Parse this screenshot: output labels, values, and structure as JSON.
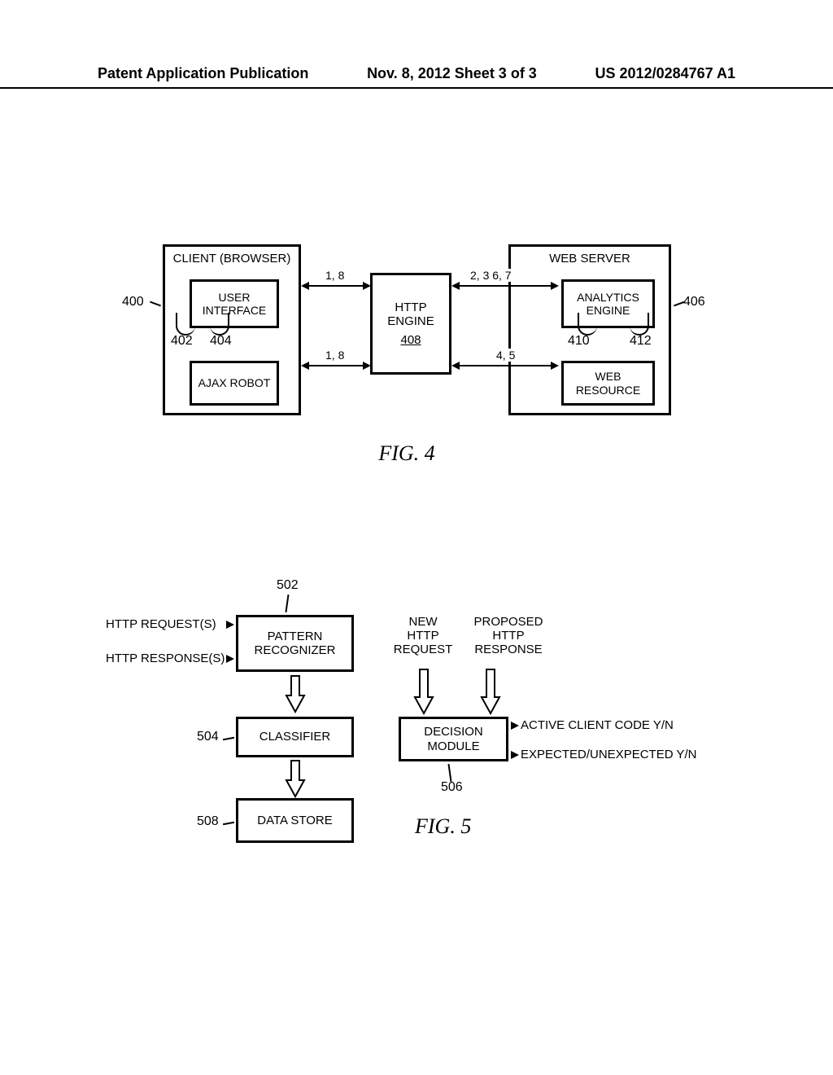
{
  "header": {
    "left": "Patent Application Publication",
    "center": "Nov. 8, 2012  Sheet 3 of 3",
    "right": "US 2012/0284767 A1"
  },
  "fig4": {
    "client_title": "CLIENT (BROWSER)",
    "user_interface": "USER INTERFACE",
    "ajax_robot": "AJAX ROBOT",
    "http_engine_top": "HTTP",
    "http_engine_mid": "ENGINE",
    "http_engine_ref": "408",
    "server_title": "WEB SERVER",
    "analytics_engine": "ANALYTICS ENGINE",
    "web_resource": "WEB RESOURCE",
    "edge_left_top": "1, 8",
    "edge_left_bot": "1, 8",
    "edge_right_top": "2, 3  6, 7",
    "edge_right_bot": "4, 5",
    "ref_400": "400",
    "ref_402": "402",
    "ref_404": "404",
    "ref_406": "406",
    "ref_410": "410",
    "ref_412": "412",
    "caption": "FIG. 4"
  },
  "fig5": {
    "http_requests": "HTTP REQUEST(S)",
    "http_responses": "HTTP RESPONSE(S)",
    "pattern_recognizer": "PATTERN RECOGNIZER",
    "classifier": "CLASSIFIER",
    "data_store": "DATA STORE",
    "decision_module": "DECISION MODULE",
    "new_http_request_l1": "NEW",
    "new_http_request_l2": "HTTP",
    "new_http_request_l3": "REQUEST",
    "proposed_http_response_l1": "PROPOSED",
    "proposed_http_response_l2": "HTTP",
    "proposed_http_response_l3": "RESPONSE",
    "active_client": "ACTIVE CLIENT CODE Y/N",
    "expected": "EXPECTED/UNEXPECTED Y/N",
    "ref_502": "502",
    "ref_504": "504",
    "ref_506": "506",
    "ref_508": "508",
    "caption": "FIG. 5"
  },
  "chart_data": [
    {
      "type": "diagram",
      "figure": "FIG. 4",
      "nodes": [
        {
          "id": "client",
          "label": "CLIENT (BROWSER)",
          "ref": 400
        },
        {
          "id": "ui",
          "label": "USER INTERFACE",
          "ref": 402,
          "parent": "client"
        },
        {
          "id": "ajax",
          "label": "AJAX ROBOT",
          "ref": 404,
          "parent": "client"
        },
        {
          "id": "http",
          "label": "HTTP ENGINE",
          "ref": 408
        },
        {
          "id": "server",
          "label": "WEB SERVER",
          "ref": 406
        },
        {
          "id": "analytic",
          "label": "ANALYTICS ENGINE",
          "ref": 412,
          "parent": "server"
        },
        {
          "id": "webres",
          "label": "WEB RESOURCE",
          "ref": 410,
          "parent": "server"
        }
      ],
      "edges": [
        {
          "from": "ui",
          "to": "http",
          "label": "1, 8",
          "bidirectional": true
        },
        {
          "from": "ajax",
          "to": "http",
          "label": "1, 8",
          "bidirectional": true
        },
        {
          "from": "http",
          "to": "analytic",
          "label": "2, 3  6, 7",
          "bidirectional": true
        },
        {
          "from": "http",
          "to": "webres",
          "label": "4, 5",
          "bidirectional": true
        }
      ]
    },
    {
      "type": "diagram",
      "figure": "FIG. 5",
      "nodes": [
        {
          "id": "recognizer",
          "label": "PATTERN RECOGNIZER",
          "ref": 502
        },
        {
          "id": "classifier",
          "label": "CLASSIFIER",
          "ref": 504
        },
        {
          "id": "decision",
          "label": "DECISION MODULE",
          "ref": 506
        },
        {
          "id": "store",
          "label": "DATA STORE",
          "ref": 508
        }
      ],
      "inputs": [
        {
          "to": "recognizer",
          "label": "HTTP REQUEST(S)"
        },
        {
          "to": "recognizer",
          "label": "HTTP RESPONSE(S)"
        },
        {
          "to": "decision",
          "label": "NEW HTTP REQUEST"
        },
        {
          "to": "decision",
          "label": "PROPOSED HTTP RESPONSE"
        }
      ],
      "outputs": [
        {
          "from": "decision",
          "label": "ACTIVE CLIENT CODE Y/N"
        },
        {
          "from": "decision",
          "label": "EXPECTED/UNEXPECTED Y/N"
        }
      ],
      "edges": [
        {
          "from": "recognizer",
          "to": "classifier"
        },
        {
          "from": "classifier",
          "to": "store"
        }
      ]
    }
  ]
}
